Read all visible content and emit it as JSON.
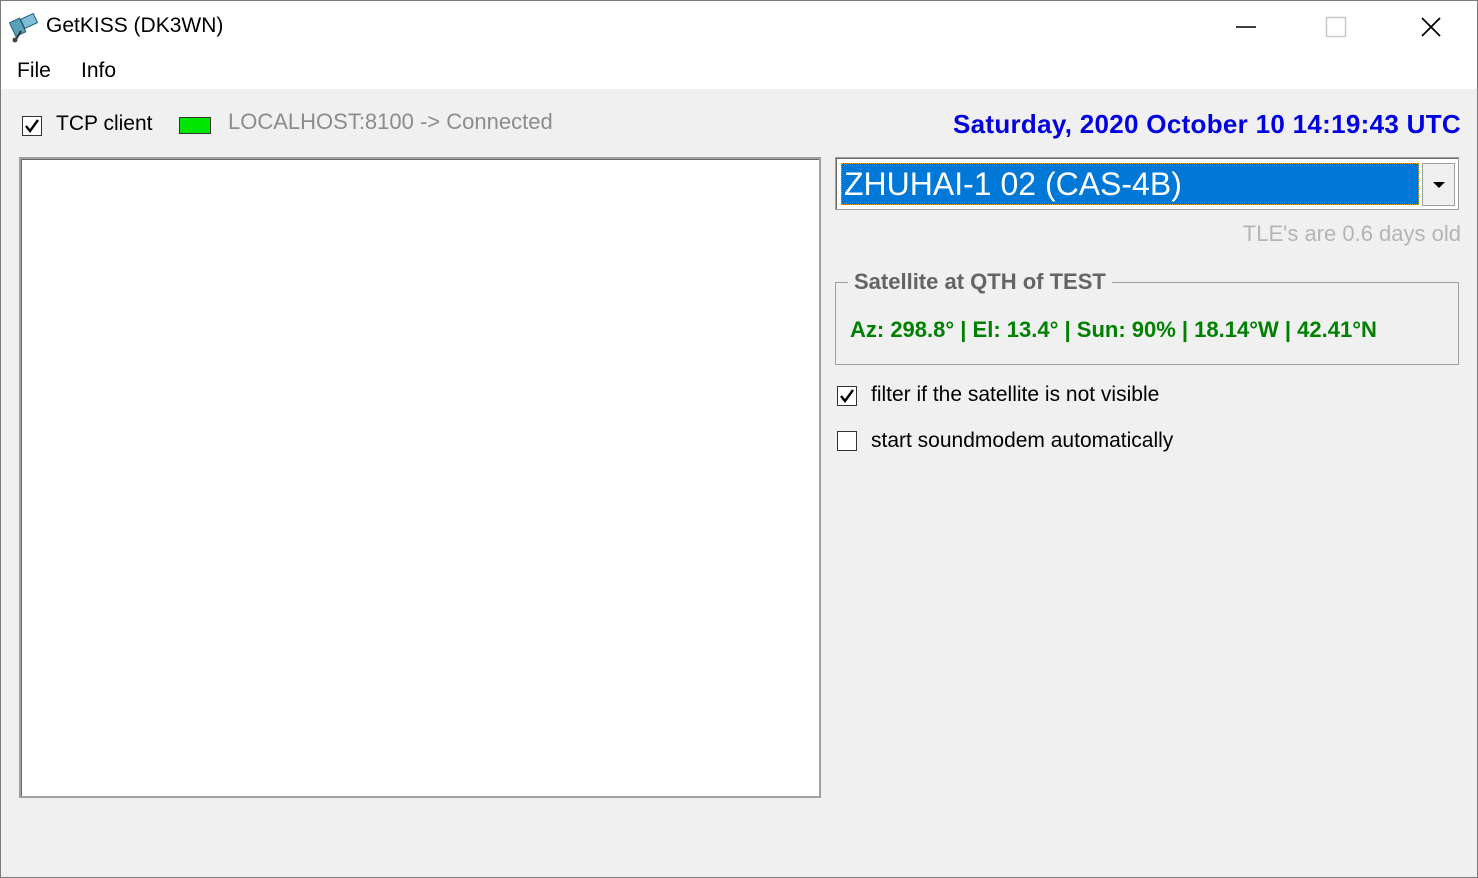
{
  "window": {
    "title": "GetKISS (DK3WN)",
    "controls": [
      "minimize",
      "maximize",
      "close"
    ]
  },
  "menu": {
    "items": [
      {
        "label": "File"
      },
      {
        "label": "Info"
      }
    ]
  },
  "connection": {
    "tcp_client_label": "TCP client",
    "tcp_client_checked": true,
    "status_color": "#00e600",
    "status_text": "LOCALHOST:8100 -> Connected"
  },
  "datetime": "Saturday, 2020 October 10  14:19:43 UTC",
  "satellite_select": {
    "selected": "ZHUHAI-1 02 (CAS-4B)"
  },
  "tle_age": "TLE's are 0.6 days old",
  "satellite_group": {
    "title": "Satellite at QTH of TEST",
    "info": "Az: 298.8° | El: 13.4° | Sun: 90% | 18.14°W | 42.41°N"
  },
  "options": {
    "filter_label": "filter if the satellite is not visible",
    "filter_checked": true,
    "soundmodem_label": "start soundmodem automatically",
    "soundmodem_checked": false
  },
  "colors": {
    "datetime": "#0000e0",
    "selection": "#0078d7",
    "sat_info": "#008000"
  }
}
